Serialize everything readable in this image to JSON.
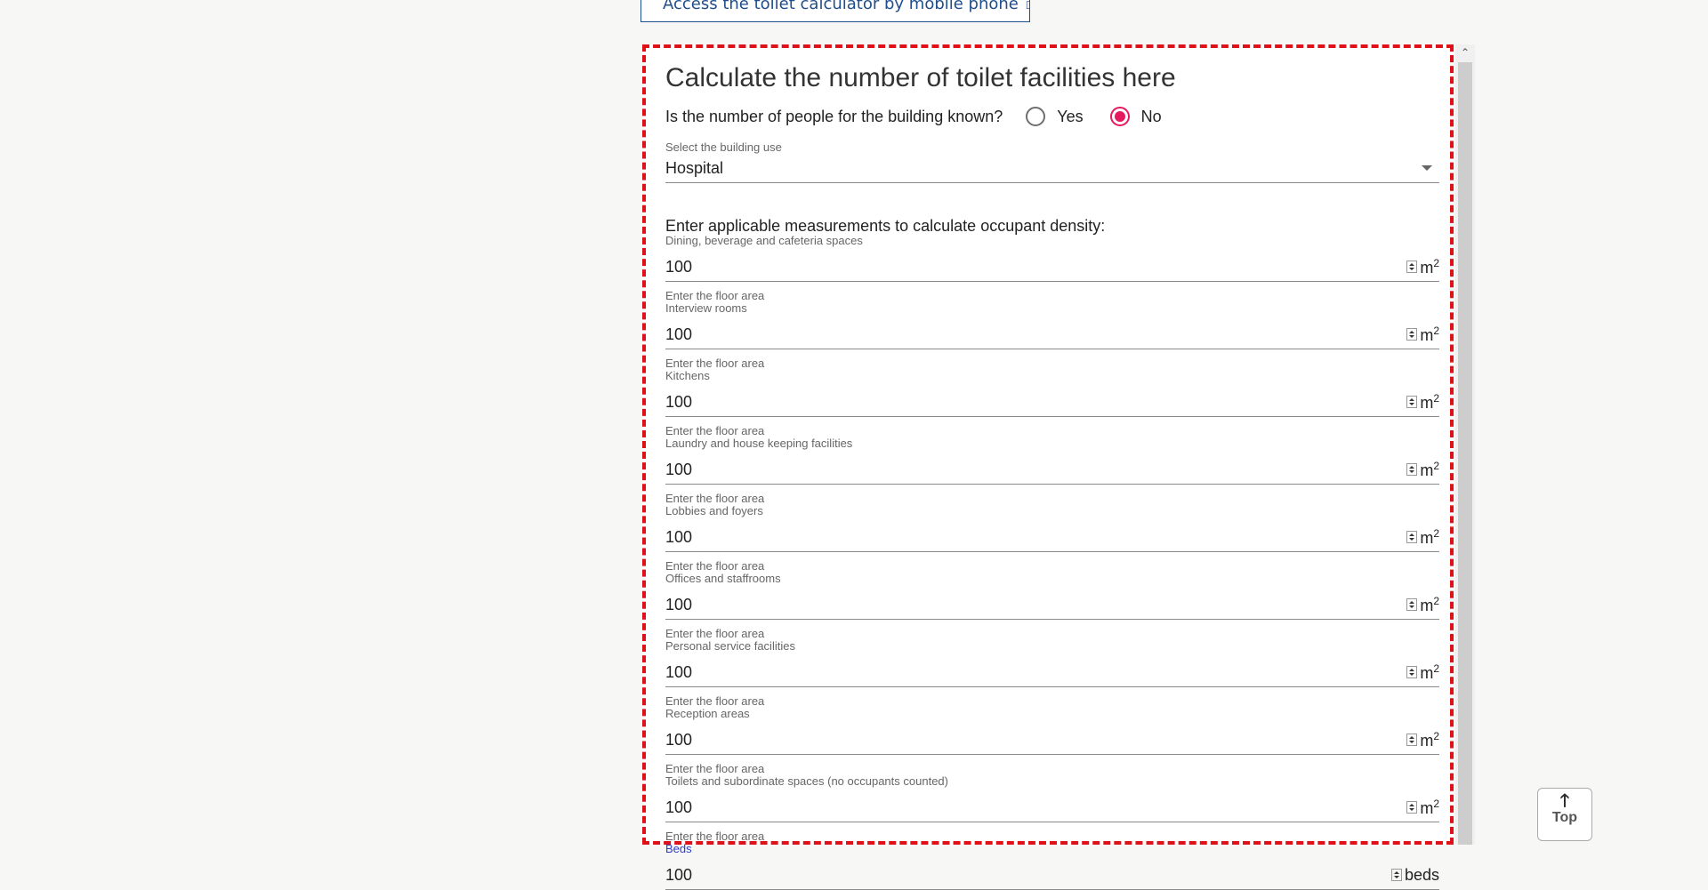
{
  "mobile_link": {
    "label": "Access the toilet calculator by mobile phone",
    "ext_icon": "external-link-icon"
  },
  "calculator": {
    "title": "Calculate the number of toilet facilities here",
    "known_question": "Is the number of people for the building known?",
    "options": {
      "yes": "Yes",
      "no": "No",
      "selected": "No"
    },
    "building_use": {
      "label": "Select the building use",
      "value": "Hospital"
    },
    "density_title": "Enter applicable measurements to calculate occupant density:",
    "fields": [
      {
        "label": "Dining, beverage and cafeteria spaces",
        "value": "100",
        "unit": "m",
        "unit_sup": "2",
        "hint": "Enter the floor area"
      },
      {
        "label": "Interview rooms",
        "value": "100",
        "unit": "m",
        "unit_sup": "2",
        "hint": "Enter the floor area"
      },
      {
        "label": "Kitchens",
        "value": "100",
        "unit": "m",
        "unit_sup": "2",
        "hint": "Enter the floor area"
      },
      {
        "label": "Laundry and house keeping facilities",
        "value": "100",
        "unit": "m",
        "unit_sup": "2",
        "hint": "Enter the floor area"
      },
      {
        "label": "Lobbies and foyers",
        "value": "100",
        "unit": "m",
        "unit_sup": "2",
        "hint": "Enter the floor area"
      },
      {
        "label": "Offices and staffrooms",
        "value": "100",
        "unit": "m",
        "unit_sup": "2",
        "hint": "Enter the floor area"
      },
      {
        "label": "Personal service facilities",
        "value": "100",
        "unit": "m",
        "unit_sup": "2",
        "hint": "Enter the floor area"
      },
      {
        "label": "Reception areas",
        "value": "100",
        "unit": "m",
        "unit_sup": "2",
        "hint": "Enter the floor area"
      },
      {
        "label": "Toilets and subordinate spaces (no occupants counted)",
        "value": "100",
        "unit": "m",
        "unit_sup": "2",
        "hint": "Enter the floor area"
      },
      {
        "label": "Beds",
        "value": "100",
        "unit": "beds",
        "unit_sup": "",
        "hint": ""
      }
    ]
  },
  "top_button": {
    "label": "Top",
    "icon": "arrow-up-icon"
  },
  "colors": {
    "accent_red": "#e01019",
    "radio_pink": "#e5195e",
    "link_blue": "#1f4e8c",
    "active_label_blue": "#2b3cc8"
  }
}
